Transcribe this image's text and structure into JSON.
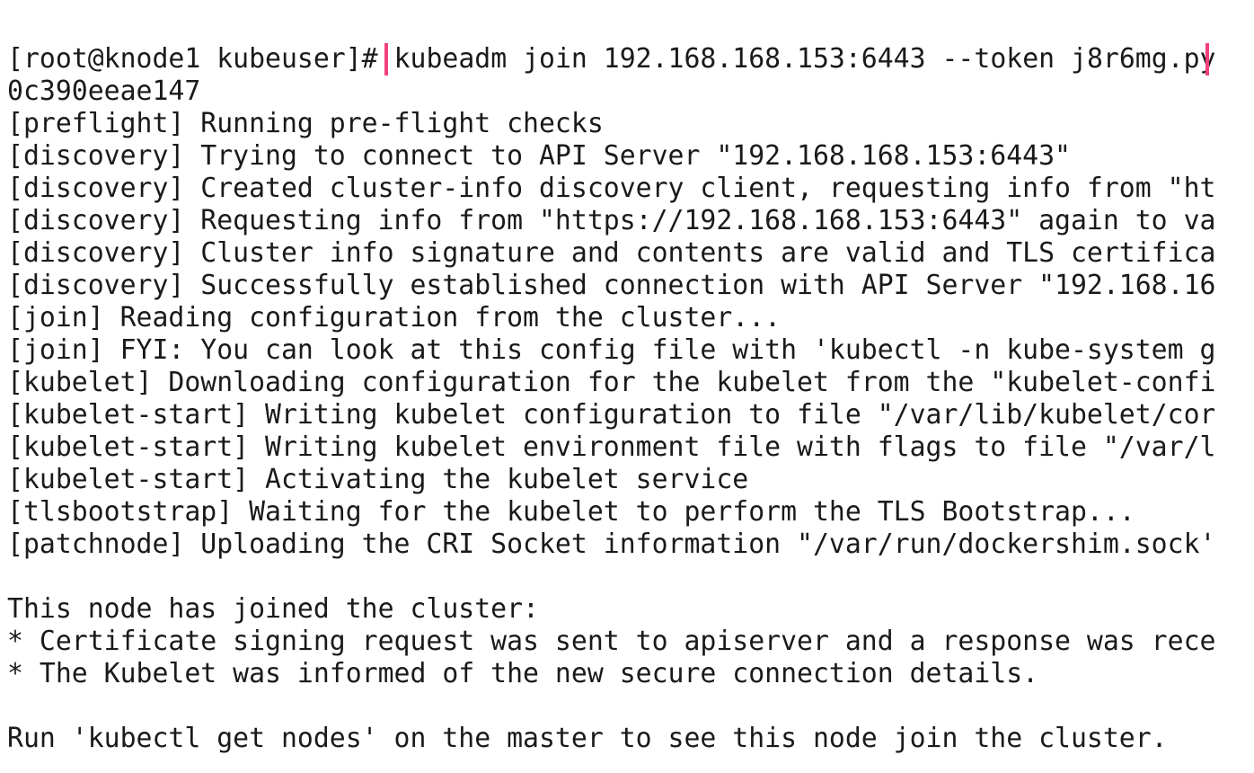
{
  "terminal": {
    "prompt": "[root@knode1 kubeuser]#",
    "command": "kubeadm join 192.168.168.153:6443 --token j8r6mg.py",
    "command_wrap": "0c390eeae147",
    "highlight_color": "#f0417a",
    "output": [
      "[preflight] Running pre-flight checks",
      "[discovery] Trying to connect to API Server \"192.168.168.153:6443\"",
      "[discovery] Created cluster-info discovery client, requesting info from \"ht",
      "[discovery] Requesting info from \"https://192.168.168.153:6443\" again to va",
      "[discovery] Cluster info signature and contents are valid and TLS certifica",
      "[discovery] Successfully established connection with API Server \"192.168.16",
      "[join] Reading configuration from the cluster...",
      "[join] FYI: You can look at this config file with 'kubectl -n kube-system g",
      "[kubelet] Downloading configuration for the kubelet from the \"kubelet-confi",
      "[kubelet-start] Writing kubelet configuration to file \"/var/lib/kubelet/cor",
      "[kubelet-start] Writing kubelet environment file with flags to file \"/var/l",
      "[kubelet-start] Activating the kubelet service",
      "[tlsbootstrap] Waiting for the kubelet to perform the TLS Bootstrap...",
      "[patchnode] Uploading the CRI Socket information \"/var/run/dockershim.sock'"
    ],
    "joined": [
      "This node has joined the cluster:",
      "* Certificate signing request was sent to apiserver and a response was rece",
      "* The Kubelet was informed of the new secure connection details."
    ],
    "final": "Run 'kubectl get nodes' on the master to see this node join the cluster."
  }
}
